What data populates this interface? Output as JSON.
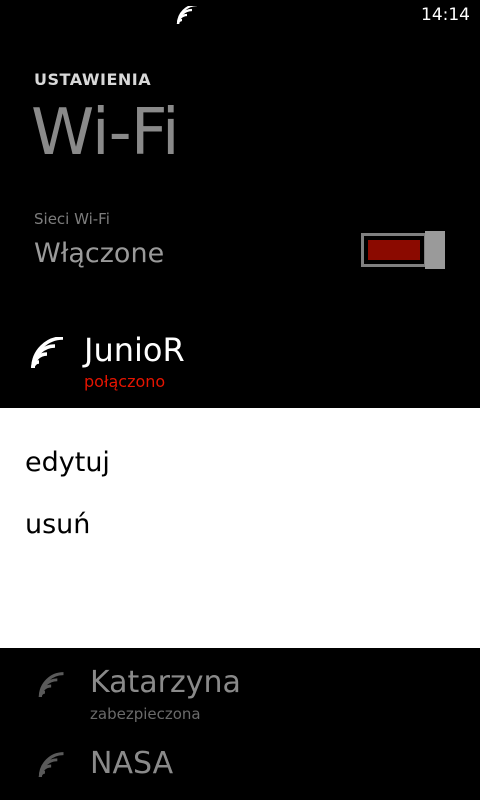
{
  "status_bar": {
    "time": "14:14",
    "wifi_icon": "wifi-signal-icon"
  },
  "header": {
    "app_title": "USTAWIENIA",
    "page_title": "Wi-Fi"
  },
  "toggle": {
    "label": "Sieci Wi-Fi",
    "state": "Włączone",
    "on": true,
    "accent": "#8b0a00"
  },
  "networks": [
    {
      "name": "JunioR",
      "status": "połączono",
      "status_color": "#e51400"
    },
    {
      "name": "Katarzyna",
      "status": "zabezpieczona"
    },
    {
      "name": "NASA",
      "status": ""
    }
  ],
  "context_menu": {
    "items": [
      {
        "label": "edytuj"
      },
      {
        "label": "usuń"
      }
    ]
  }
}
